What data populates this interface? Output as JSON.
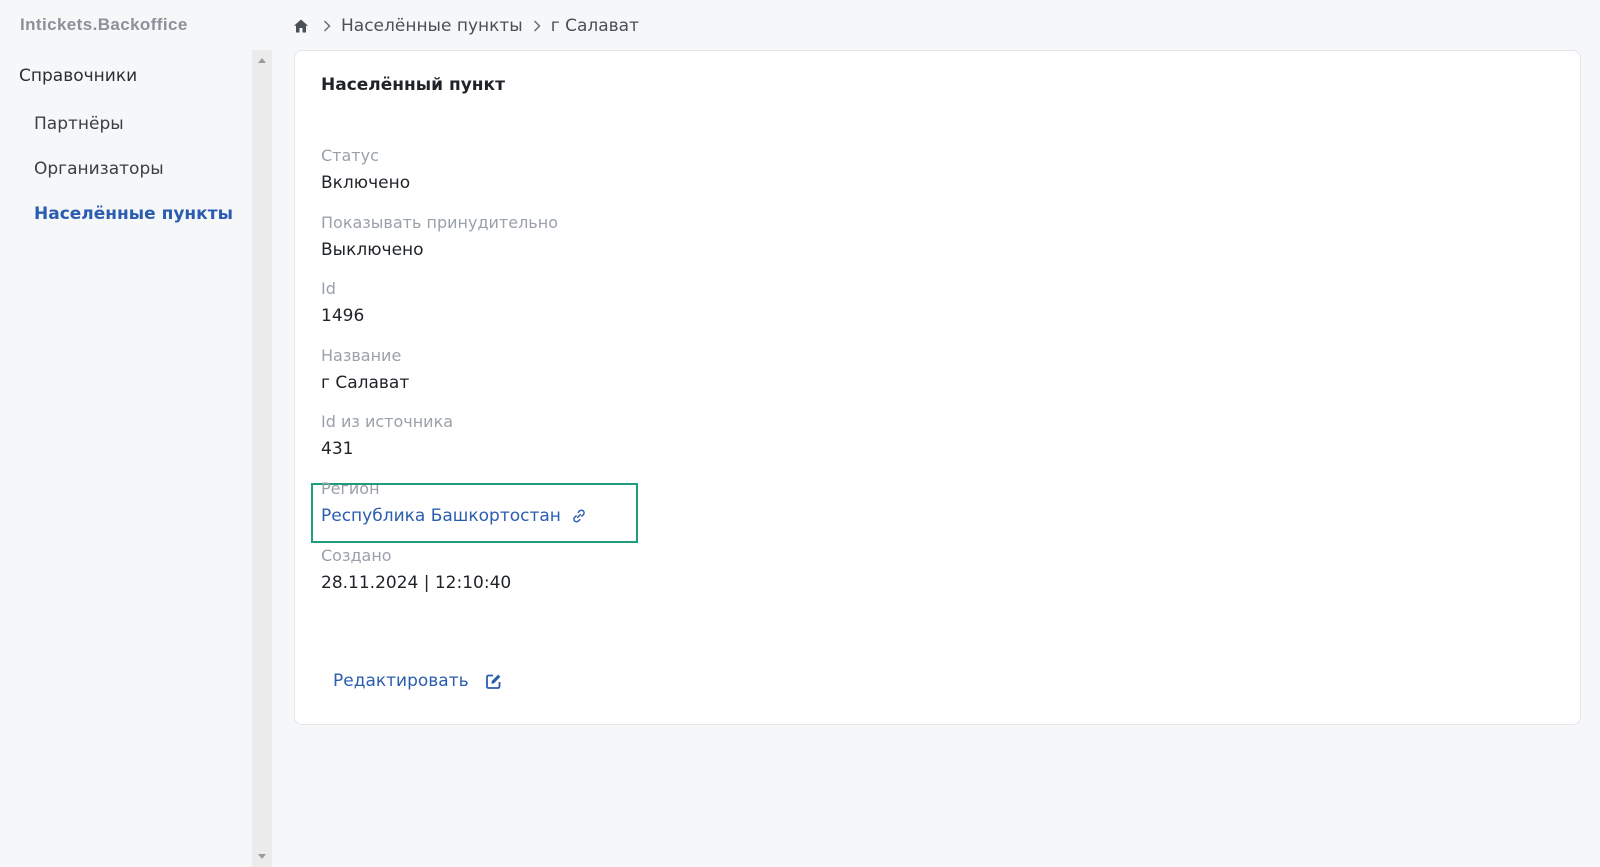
{
  "brand": "Intickets.Backoffice",
  "sidebar": {
    "heading": "Справочники",
    "items": [
      {
        "label": "Партнёры",
        "active": false
      },
      {
        "label": "Организаторы",
        "active": false
      },
      {
        "label": "Населённые пункты",
        "active": true
      }
    ]
  },
  "breadcrumb": {
    "home_icon": "home-icon",
    "items": [
      "Населённые пункты",
      "г Салават"
    ]
  },
  "card": {
    "title": "Населённый пункт",
    "fields": [
      {
        "label": "Статус",
        "value": "Включено"
      },
      {
        "label": "Показывать принудительно",
        "value": "Выключено"
      },
      {
        "label": "Id",
        "value": "1496"
      },
      {
        "label": "Название",
        "value": "г Салават"
      },
      {
        "label": "Id из источника",
        "value": "431"
      },
      {
        "label": "Регион",
        "value": "Республика Башкортостан",
        "link_icon": "link-icon"
      },
      {
        "label": "Создано",
        "value": "28.11.2024 | 12:10:40"
      }
    ],
    "edit_label": "Редактировать",
    "edit_icon": "edit-icon"
  },
  "colors": {
    "accent": "#2a5db0",
    "highlight_border": "#1f9d7a",
    "muted_label": "#9aa1a9"
  }
}
